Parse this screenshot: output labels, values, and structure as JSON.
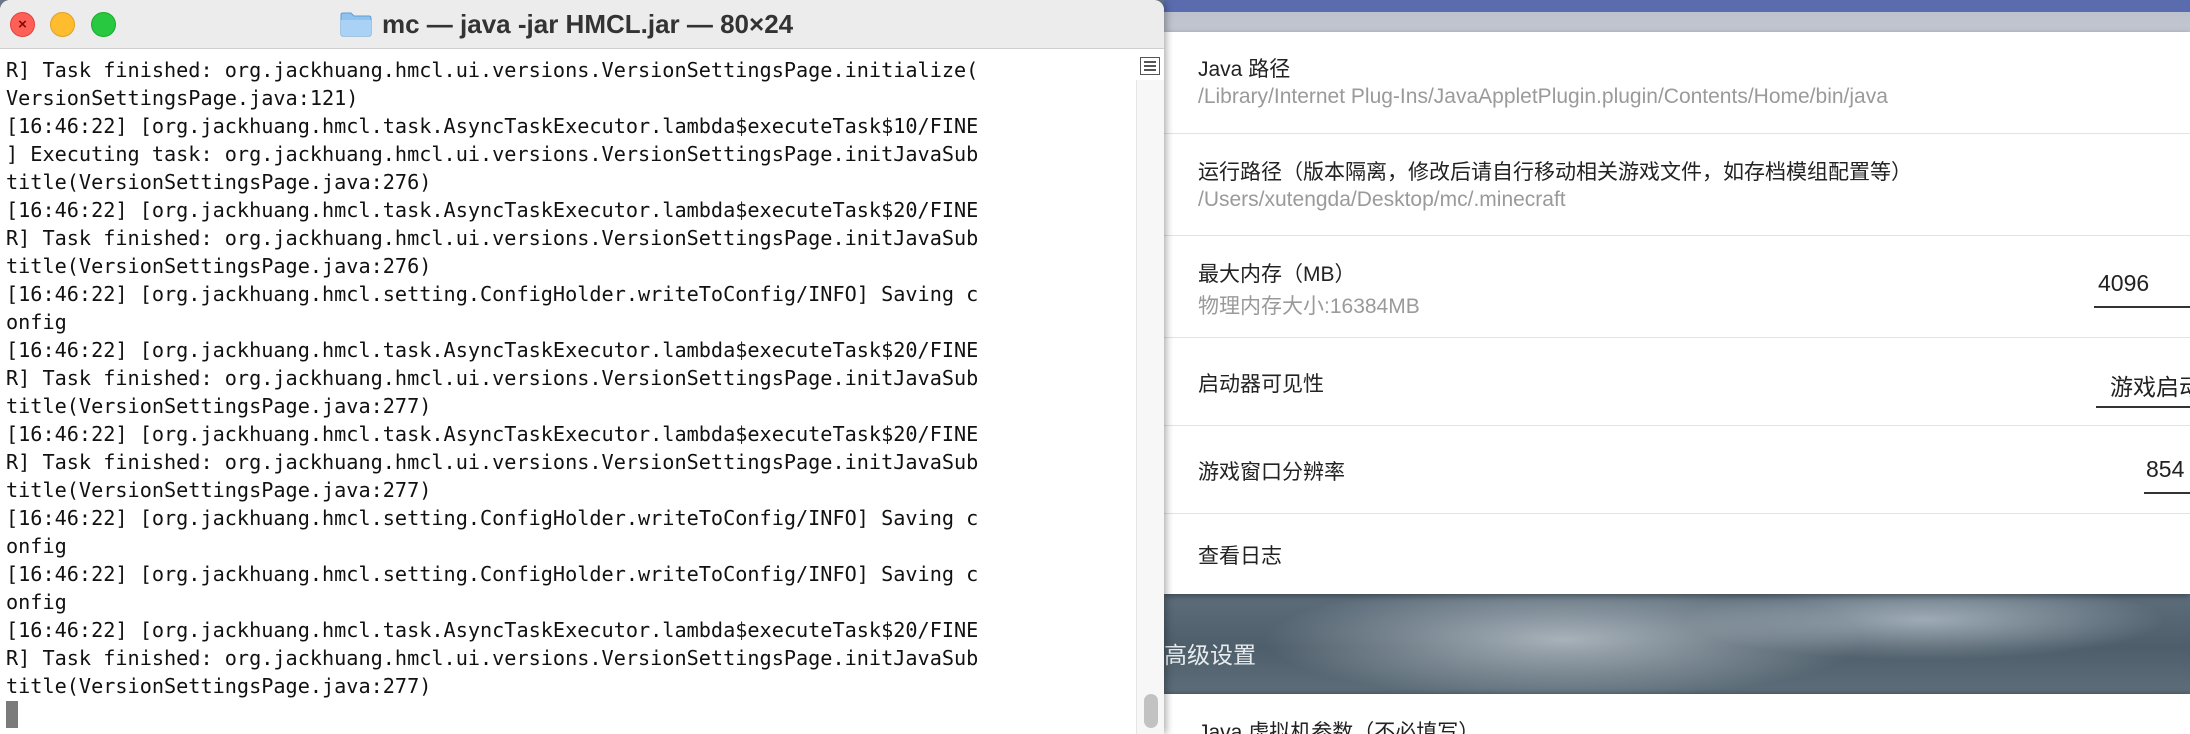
{
  "terminal": {
    "window_title": "mc — java -jar HMCL.jar — 80×24",
    "lines": [
      "R] Task finished: org.jackhuang.hmcl.ui.versions.VersionSettingsPage.initialize(",
      "VersionSettingsPage.java:121)",
      "[16:46:22] [org.jackhuang.hmcl.task.AsyncTaskExecutor.lambda$executeTask$10/FINE",
      "] Executing task: org.jackhuang.hmcl.ui.versions.VersionSettingsPage.initJavaSub",
      "title(VersionSettingsPage.java:276)",
      "[16:46:22] [org.jackhuang.hmcl.task.AsyncTaskExecutor.lambda$executeTask$20/FINE",
      "R] Task finished: org.jackhuang.hmcl.ui.versions.VersionSettingsPage.initJavaSub",
      "title(VersionSettingsPage.java:276)",
      "[16:46:22] [org.jackhuang.hmcl.setting.ConfigHolder.writeToConfig/INFO] Saving c",
      "onfig",
      "[16:46:22] [org.jackhuang.hmcl.task.AsyncTaskExecutor.lambda$executeTask$20/FINE",
      "R] Task finished: org.jackhuang.hmcl.ui.versions.VersionSettingsPage.initJavaSub",
      "title(VersionSettingsPage.java:277)",
      "[16:46:22] [org.jackhuang.hmcl.task.AsyncTaskExecutor.lambda$executeTask$20/FINE",
      "R] Task finished: org.jackhuang.hmcl.ui.versions.VersionSettingsPage.initJavaSub",
      "title(VersionSettingsPage.java:277)",
      "[16:46:22] [org.jackhuang.hmcl.setting.ConfigHolder.writeToConfig/INFO] Saving c",
      "onfig",
      "[16:46:22] [org.jackhuang.hmcl.setting.ConfigHolder.writeToConfig/INFO] Saving c",
      "onfig",
      "[16:46:22] [org.jackhuang.hmcl.task.AsyncTaskExecutor.lambda$executeTask$20/FINE",
      "R] Task finished: org.jackhuang.hmcl.ui.versions.VersionSettingsPage.initJavaSub",
      "title(VersionSettingsPage.java:277)"
    ],
    "icons": {
      "folder": "folder-icon",
      "sidebar": "sidebar-toggle-icon"
    }
  },
  "settings": {
    "java_path": {
      "title": "Java 路径",
      "value": "/Library/Internet Plug-Ins/JavaAppletPlugin.plugin/Contents/Home/bin/java"
    },
    "run_path": {
      "title": "运行路径（版本隔离，修改后请自行移动相关游戏文件，如存档模组配置等）",
      "value": "/Users/xutengda/Desktop/mc/.minecraft"
    },
    "max_memory": {
      "title": "最大内存（MB）",
      "subtitle": "物理内存大小:16384MB",
      "value": "4096"
    },
    "launcher_visibility": {
      "title": "启动器可见性",
      "value": "游戏启动"
    },
    "window_resolution": {
      "title": "游戏窗口分辨率",
      "value": "854"
    },
    "view_log": {
      "title": "查看日志"
    },
    "advanced_label": "高级设置",
    "jvm_args": {
      "title": "Java 虚拟机参数（不必填写）"
    }
  },
  "colors": {
    "close": "#fe5f57",
    "minimize": "#febc2e",
    "maximize": "#28c840",
    "accent_strip": "#5a6cae"
  }
}
